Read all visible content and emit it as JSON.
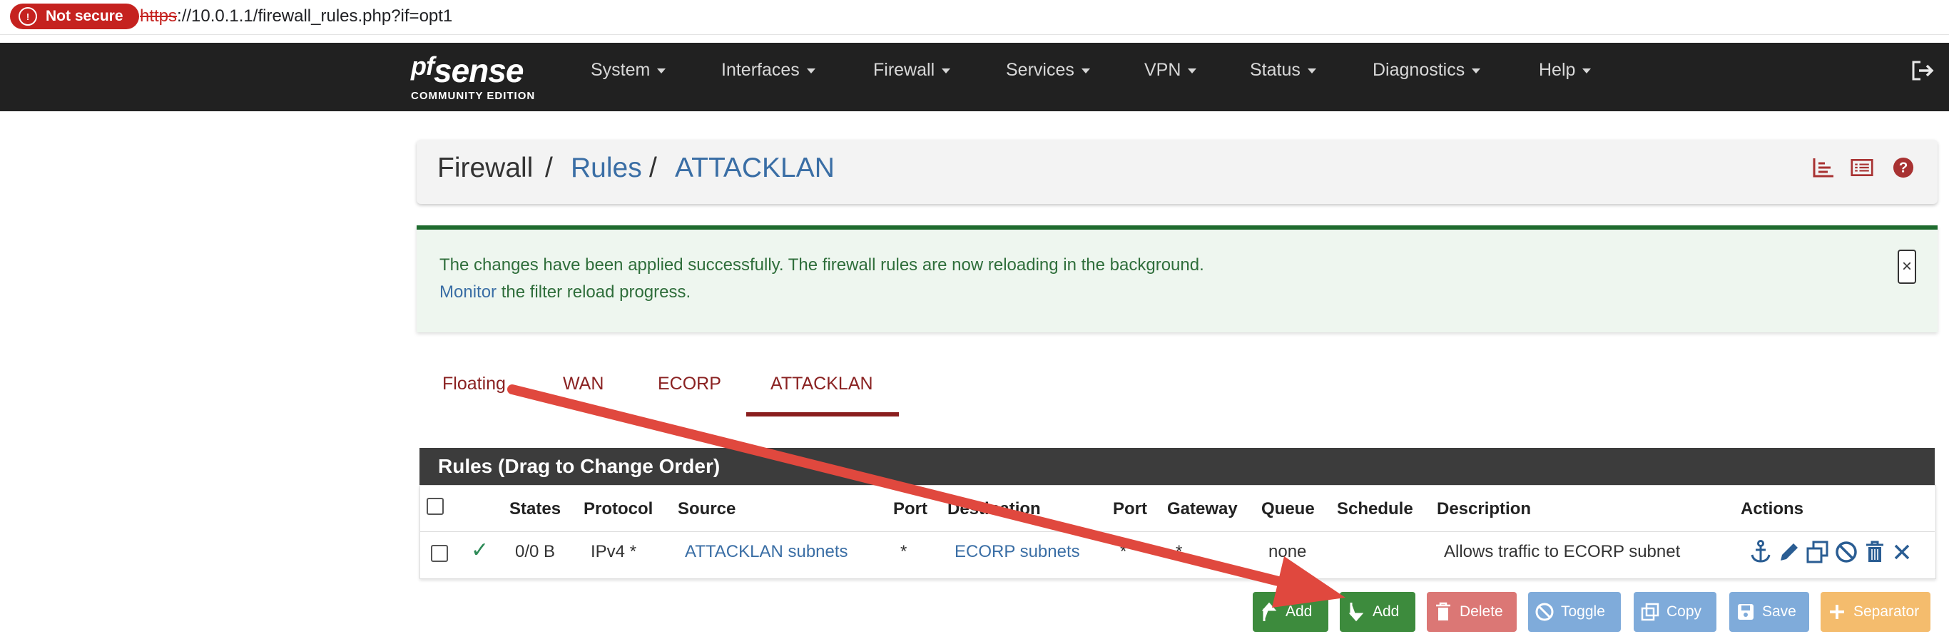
{
  "browser": {
    "security_label": "Not secure",
    "url_scheme": "https",
    "url_rest": "://10.0.1.1/firewall_rules.php?if=opt1"
  },
  "navbar": {
    "logo_main": "sense",
    "logo_prefix": "pf",
    "logo_sub": "COMMUNITY EDITION",
    "items": [
      "System",
      "Interfaces",
      "Firewall",
      "Services",
      "VPN",
      "Status",
      "Diagnostics",
      "Help"
    ]
  },
  "breadcrumb": {
    "part1": "Firewall",
    "sep": "/",
    "part2": "Rules",
    "part3": "ATTACKLAN"
  },
  "alert": {
    "line1": "The changes have been applied successfully. The firewall rules are now reloading in the background.",
    "line2_link": "Monitor",
    "line2_rest": " the filter reload progress.",
    "close": "×"
  },
  "tabs": [
    "Floating",
    "WAN",
    "ECORP",
    "ATTACKLAN"
  ],
  "active_tab": "ATTACKLAN",
  "rules": {
    "title": "Rules (Drag to Change Order)",
    "columns": [
      "States",
      "Protocol",
      "Source",
      "Port",
      "Destination",
      "Port",
      "Gateway",
      "Queue",
      "Schedule",
      "Description",
      "Actions"
    ],
    "rows": [
      {
        "status": "✓",
        "states": "0/0 B",
        "protocol": "IPv4 *",
        "source": "ATTACKLAN subnets",
        "src_port": "*",
        "destination": "ECORP subnets",
        "dst_port": "*",
        "gateway": "*",
        "queue": "none",
        "schedule": "",
        "description": "Allows traffic to ECORP subnet"
      }
    ]
  },
  "buttons": {
    "add_top": "Add",
    "add_bottom": "Add",
    "delete": "Delete",
    "toggle": "Toggle",
    "copy": "Copy",
    "save": "Save",
    "separator": "Separator"
  },
  "colors": {
    "navbar_bg": "#212121",
    "link": "#3a6ea5",
    "success_green": "#1e6b2e",
    "btn_green": "#3d8b3d",
    "btn_red": "#c9302c",
    "btn_blue": "#3c7fc7",
    "btn_orange": "#f0a030",
    "tab_red": "#8a1e1e",
    "arrow_red": "#e0483e"
  },
  "icons": [
    "shield-icon",
    "logout-icon",
    "chart-icon",
    "list-icon",
    "help-icon",
    "anchor-icon",
    "pencil-icon",
    "copy-icon",
    "disable-icon",
    "trash-icon",
    "close-icon",
    "check-icon"
  ]
}
